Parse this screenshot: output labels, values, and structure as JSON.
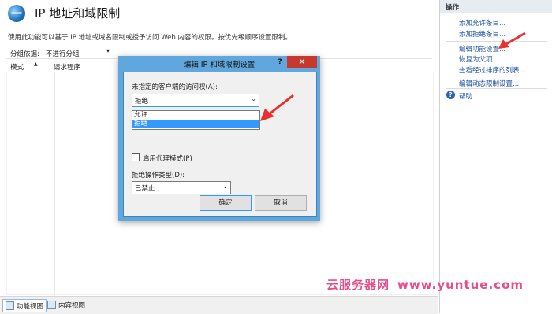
{
  "page": {
    "title": "IP 地址和域限制",
    "description": "使用此功能可以基于 IP 地址或域名限制或授予访问 Web 内容的权限。按优先级顺序设置限制。"
  },
  "grouping": {
    "label": "分组依据:",
    "value": "不进行分组"
  },
  "list": {
    "columns": [
      "模式",
      "请求程序"
    ]
  },
  "bottom_tabs": [
    "功能视图",
    "内容视图"
  ],
  "actions": {
    "header": "操作",
    "items": [
      "添加允许条目...",
      "添加拒绝条目...",
      "编辑功能设置...",
      "恢复为父项",
      "查看经过排序的列表...",
      "编辑动态限制设置..."
    ],
    "help": "帮助"
  },
  "dialog": {
    "title": "编辑 IP 和域限制设置",
    "help_glyph": "?",
    "close_glyph": "✕",
    "access_label": "未指定的客户端的访问权(A):",
    "access_value": "拒绝",
    "access_options": [
      "允许",
      "拒绝"
    ],
    "access_selected": "拒绝",
    "proxy_label": "启用代理模式(P)",
    "proxy_checked": false,
    "deny_type_label": "拒绝操作类型(D):",
    "deny_type_value": "已禁止",
    "ok_label": "确定",
    "cancel_label": "取消"
  },
  "watermark": {
    "brand": "云服务器网",
    "url": "www.yuntue.com"
  },
  "colors": {
    "dialog_frame": "#5fa7dc",
    "close_button": "#c7382f",
    "selection": "#3399ff",
    "link": "#1a4fa0",
    "annotation_arrow": "#e8312f",
    "watermark": "#e84c8a"
  }
}
